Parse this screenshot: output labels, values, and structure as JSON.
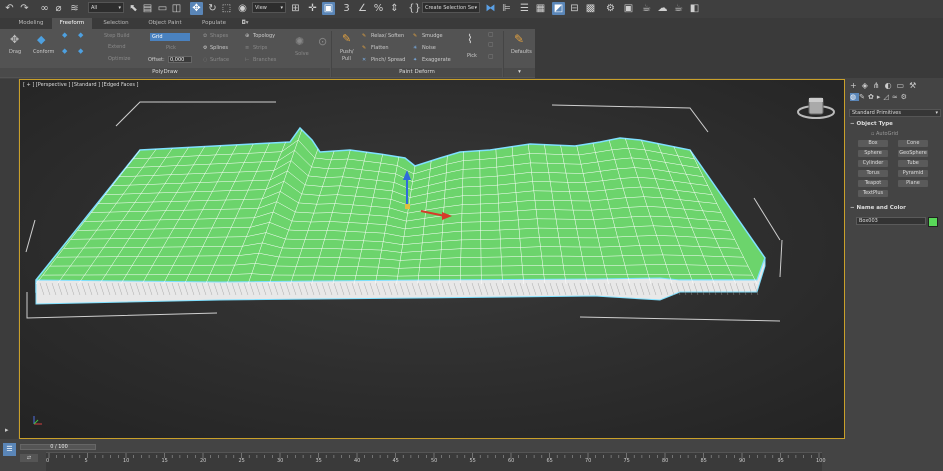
{
  "toolbar": {
    "selection_filter": "All",
    "ref_coord": "View",
    "named_selection_placeholder": "Create Selection Se",
    "icons": [
      "undo-icon",
      "redo-icon",
      "link-icon",
      "unlink-icon",
      "bind-spacewarp-icon",
      "select-object-icon",
      "select-by-name-icon",
      "rectangular-selection-icon",
      "window-crossing-icon",
      "select-and-move-icon",
      "select-and-rotate-icon",
      "select-and-scale-icon",
      "select-and-place-icon",
      "pivot-center-icon",
      "select-manipulate-icon",
      "keyboard-shortcut-icon",
      "snaps-toggle-icon",
      "angle-snap-icon",
      "percent-snap-icon",
      "spinner-snap-icon",
      "edit-named-selections-icon",
      "mirror-icon",
      "align-icon",
      "layer-explorer-icon",
      "toggle-ribbon-icon",
      "curve-editor-icon",
      "schematic-view-icon",
      "material-editor-icon",
      "render-setup-icon",
      "rendered-frame-icon",
      "render-icon",
      "render-cloud-icon"
    ]
  },
  "tabs": [
    "Modeling",
    "Freeform",
    "Selection",
    "Object Paint",
    "Populate"
  ],
  "active_tab": "Freeform",
  "ribbon": {
    "polydraw": {
      "drag": "Drag",
      "conform": "Conform",
      "step_build": "Step Build",
      "extend": "Extend",
      "optimize": "Optimize",
      "grid_value": "Grid",
      "pick": "Pick",
      "offset_label": "Offset:",
      "offset_value": "0,000",
      "shapes": "Shapes",
      "topology": "Topology",
      "splines": "Splines",
      "strips": "Strips",
      "surface": "Surface",
      "branches": "Branches",
      "solve": "Solve",
      "group_label": "PolyDraw"
    },
    "paint_deform": {
      "push_pull_1": "Push/",
      "push_pull_2": "Pull",
      "relax_soften": "Relax/ Soften",
      "smudge": "Smudge",
      "flatten": "Flatten",
      "noise": "Noise",
      "pinch_spread": "Pinch/ Spread",
      "exaggerate": "Exaggerate",
      "pick": "Pick",
      "group_label": "Paint Deform"
    },
    "defaults": "Defaults"
  },
  "viewport": {
    "label": "[ + ] [Perspective ] [Standard ] [Edged Faces ]",
    "mesh_color": "#6cd46c",
    "selection_color": "#7fe0ff"
  },
  "command_panel": {
    "dropdown": "Standard Primitives",
    "object_type": {
      "title": "Object Type",
      "autogrid": "AutoGrid",
      "buttons": [
        "Box",
        "Cone",
        "Sphere",
        "GeoSphere",
        "Cylinder",
        "Tube",
        "Torus",
        "Pyramid",
        "Teapot",
        "Plane",
        "TextPlus"
      ]
    },
    "name_color": {
      "title": "Name and Color",
      "name": "Box003",
      "color": "#59d859"
    }
  },
  "timeline": {
    "frame": "0 / 100",
    "ticks": [
      "0",
      "5",
      "10",
      "15",
      "20",
      "25",
      "30",
      "35",
      "40",
      "45",
      "50",
      "55",
      "60",
      "65",
      "70",
      "75",
      "80",
      "85",
      "90",
      "95",
      "100"
    ]
  }
}
